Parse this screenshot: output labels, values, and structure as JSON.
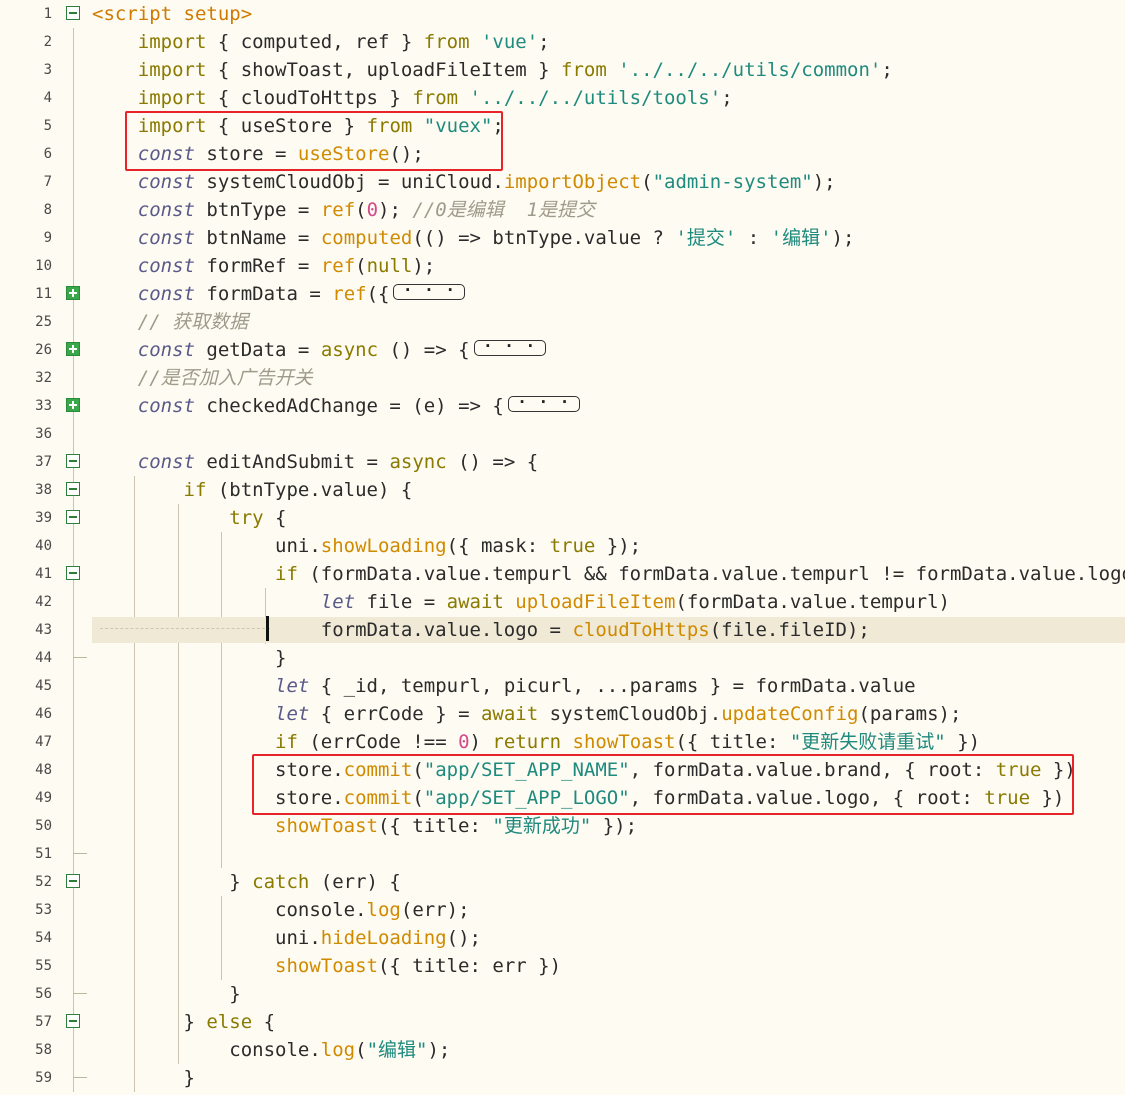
{
  "editor": {
    "language": "vue",
    "highlight_line": 43,
    "colors": {
      "background": "#fdfbf2",
      "annotation": "#e8242b",
      "fold_green": "#39a849"
    },
    "lines": [
      {
        "n": "1",
        "code": "<script setup>",
        "fold": "open"
      },
      {
        "n": "2",
        "code": "    import { computed, ref } from 'vue';"
      },
      {
        "n": "3",
        "code": "    import { showToast, uploadFileItem } from '../../../utils/common';"
      },
      {
        "n": "4",
        "code": "    import { cloudToHttps } from '../../../utils/tools';"
      },
      {
        "n": "5",
        "code": "    import { useStore } from \"vuex\";"
      },
      {
        "n": "6",
        "code": "    const store = useStore();"
      },
      {
        "n": "7",
        "code": "    const systemCloudObj = uniCloud.importObject(\"admin-system\");"
      },
      {
        "n": "8",
        "code": "    const btnType = ref(0); //0是编辑  1是提交"
      },
      {
        "n": "9",
        "code": "    const btnName = computed(() => btnType.value ? '提交' : '编辑');"
      },
      {
        "n": "10",
        "code": "    const formRef = ref(null);"
      },
      {
        "n": "11",
        "code": "    const formData = ref({",
        "fold": "collapsed",
        "pill": true
      },
      {
        "n": "25",
        "code": "    // 获取数据"
      },
      {
        "n": "26",
        "code": "    const getData = async () => {",
        "fold": "collapsed",
        "pill": true
      },
      {
        "n": "32",
        "code": "    //是否加入广告开关"
      },
      {
        "n": "33",
        "code": "    const checkedAdChange = (e) => {",
        "fold": "collapsed",
        "pill": true
      },
      {
        "n": "36",
        "code": ""
      },
      {
        "n": "37",
        "code": "    const editAndSubmit = async () => {",
        "fold": "open"
      },
      {
        "n": "38",
        "code": "        if (btnType.value) {",
        "fold": "open"
      },
      {
        "n": "39",
        "code": "            try {",
        "fold": "open"
      },
      {
        "n": "40",
        "code": "                uni.showLoading({ mask: true });"
      },
      {
        "n": "41",
        "code": "                if (formData.value.tempurl && formData.value.tempurl != formData.value.logo) {",
        "fold": "open"
      },
      {
        "n": "42",
        "code": "                    let file = await uploadFileItem(formData.value.tempurl)"
      },
      {
        "n": "43",
        "code": "                    formData.value.logo = cloudToHttps(file.fileID);"
      },
      {
        "n": "44",
        "code": "                }",
        "fold_end": true
      },
      {
        "n": "45",
        "code": "                let { _id, tempurl, picurl, ...params } = formData.value"
      },
      {
        "n": "46",
        "code": "                let { errCode } = await systemCloudObj.updateConfig(params);"
      },
      {
        "n": "47",
        "code": "                if (errCode !== 0) return showToast({ title: \"更新失败请重试\" })"
      },
      {
        "n": "48",
        "code": "                store.commit(\"app/SET_APP_NAME\", formData.value.brand, { root: true })"
      },
      {
        "n": "49",
        "code": "                store.commit(\"app/SET_APP_LOGO\", formData.value.logo, { root: true })"
      },
      {
        "n": "50",
        "code": "                showToast({ title: \"更新成功\" });"
      },
      {
        "n": "51",
        "code": "",
        "fold_end": true
      },
      {
        "n": "52",
        "code": "            } catch (err) {",
        "fold": "open"
      },
      {
        "n": "53",
        "code": "                console.log(err);"
      },
      {
        "n": "54",
        "code": "                uni.hideLoading();"
      },
      {
        "n": "55",
        "code": "                showToast({ title: err })"
      },
      {
        "n": "56",
        "code": "            }",
        "fold_end": true
      },
      {
        "n": "57",
        "code": "        } else {",
        "fold": "open"
      },
      {
        "n": "58",
        "code": "            console.log(\"编辑\");"
      },
      {
        "n": "59",
        "code": "        }",
        "fold_end": true
      }
    ]
  }
}
